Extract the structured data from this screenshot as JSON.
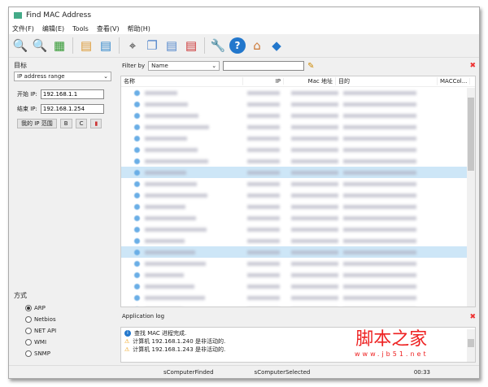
{
  "window": {
    "title": "Find MAC Address"
  },
  "menu": [
    "文件(F)",
    "编辑(E)",
    "Tools",
    "查看(V)",
    "帮助(H)"
  ],
  "toolbar": [
    "search-icon",
    "search-disabled-icon",
    "network-card-icon",
    "open-list-icon",
    "save-list-icon",
    "binoculars-icon",
    "copy-icon",
    "export-icon",
    "delete-list-icon",
    "wrench-icon",
    "help-icon",
    "home-icon",
    "info-icon"
  ],
  "target": {
    "label": "目标",
    "mode": "IP address range",
    "start_label": "开始 IP:",
    "start_value": "192.168.1.1",
    "end_label": "结束 IP:",
    "end_value": "192.168.1.254",
    "my_range": "我的 IP 范围",
    "b": "B",
    "c": "C"
  },
  "method": {
    "label": "方式",
    "options": [
      "ARP",
      "Netbios",
      "NET API",
      "WMI",
      "SNMP"
    ],
    "selected": "ARP"
  },
  "filter": {
    "label": "Filter by",
    "field": "Name",
    "value": ""
  },
  "table": {
    "columns": [
      "名称",
      "IP",
      "Mac 地址",
      "目的",
      "MACCol..."
    ]
  },
  "log": {
    "title": "Application log",
    "entries": [
      {
        "icon": "info-icon",
        "text": "查找 MAC 进程完成."
      },
      {
        "icon": "warning-icon",
        "text": "计算机 192.168.1.240 是非活动的."
      },
      {
        "icon": "warning-icon",
        "text": "计算机 192.168.1.243 是非活动的."
      }
    ]
  },
  "status": {
    "found": "sComputerFinded",
    "selected": "sComputerSelected",
    "time": "00:33"
  },
  "watermark": {
    "text": "脚本之家",
    "url": "www.jb51.net"
  }
}
